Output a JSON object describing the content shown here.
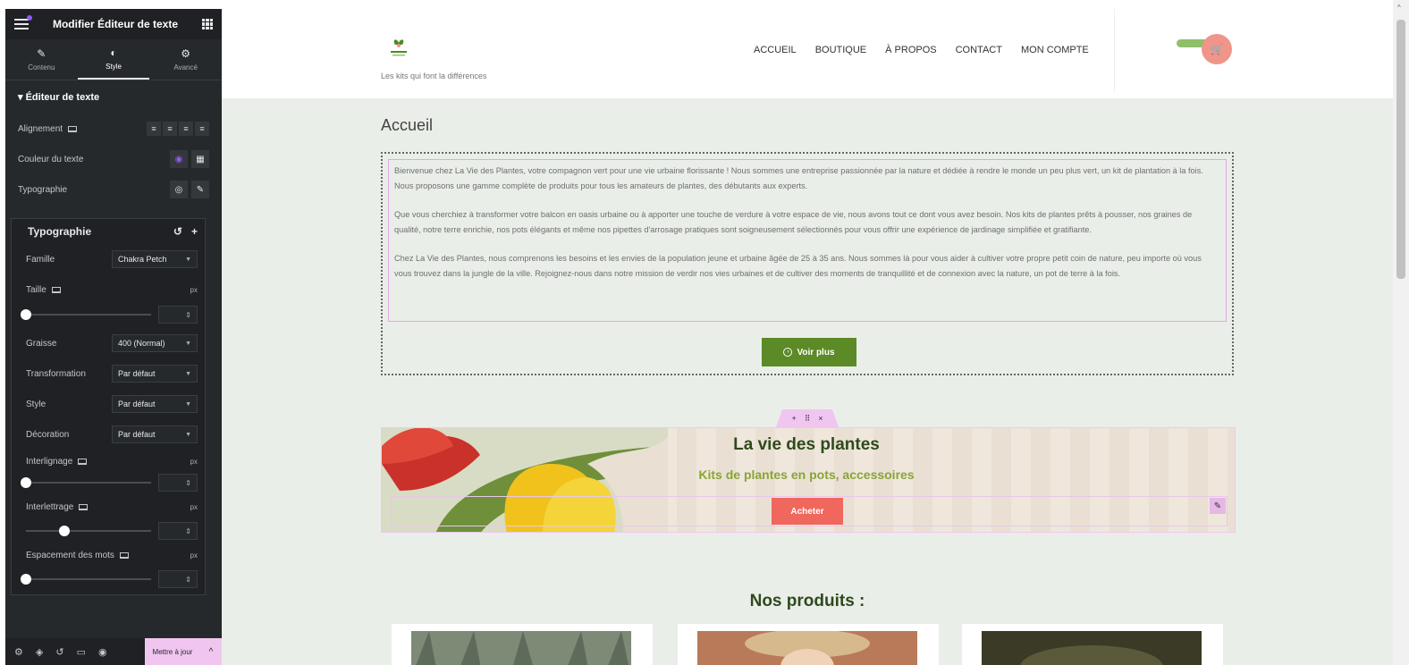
{
  "editor": {
    "title": "Modifier Éditeur de texte",
    "tabs": [
      {
        "label": "Contenu",
        "icon": "pencil-icon"
      },
      {
        "label": "Style",
        "icon": "contrast-icon"
      },
      {
        "label": "Avancé",
        "icon": "gear-icon"
      }
    ],
    "section": "Éditeur de texte",
    "rows": {
      "alignement": "Alignement",
      "couleur": "Couleur du texte",
      "typographie": "Typographie"
    },
    "typo": {
      "title": "Typographie",
      "famille_label": "Famille",
      "famille_value": "Chakra Petch",
      "taille_label": "Taille",
      "unit": "px",
      "graisse_label": "Graisse",
      "graisse_value": "400 (Normal)",
      "transformation_label": "Transformation",
      "transformation_value": "Par défaut",
      "style_label": "Style",
      "style_value": "Par défaut",
      "decoration_label": "Décoration",
      "decoration_value": "Par défaut",
      "interlignage_label": "Interlignage",
      "interlettrage_label": "Interlettrage",
      "espacement_label": "Espacement des mots"
    },
    "footer": {
      "update_label": "Mettre à jour"
    }
  },
  "site": {
    "tagline": "Les kits qui font la différences",
    "nav": [
      "ACCUEIL",
      "BOUTIQUE",
      "À PROPOS",
      "CONTACT",
      "MON COMPTE"
    ],
    "page_title": "Accueil",
    "paragraphs": [
      "Bienvenue chez La Vie des Plantes, votre compagnon vert pour une vie urbaine florissante ! Nous sommes une entreprise passionnée par la nature et dédiée à rendre le monde un peu plus vert, un kit de plantation à la fois. Nous proposons une gamme complète de produits pour tous les amateurs de plantes, des débutants aux experts.",
      "Que vous cherchiez à transformer votre balcon en oasis urbaine ou à apporter une touche de verdure à votre espace de vie, nous avons tout ce dont vous avez besoin. Nos kits de plantes prêts à pousser, nos graines de qualité, notre terre enrichie, nos pots élégants et même nos pipettes d'arrosage pratiques sont soigneusement sélectionnés pour vous offrir une expérience de jardinage simplifiée et gratifiante.",
      "Chez La Vie des Plantes, nous comprenons les besoins et les envies de la population jeune et urbaine âgée de 25 à 35 ans. Nous sommes là pour vous aider à cultiver votre propre petit coin de nature, peu importe où vous vous trouvez dans la jungle de la ville. Rejoignez-nous dans notre mission de verdir nos vies urbaines et de cultiver des moments de tranquillité et de connexion avec la nature, un pot de terre à la fois."
    ],
    "voir_plus": "Voir plus",
    "banner": {
      "title": "La vie des plantes",
      "subtitle": "Kits de plantes en pots, accessoires",
      "button": "Acheter"
    },
    "products_title": "Nos produits :"
  },
  "colors": {
    "accent_green": "#5c8a26",
    "cart_coral": "#f0958a",
    "editor_pink": "#f0c6f0",
    "buy_red": "#f0675d"
  }
}
